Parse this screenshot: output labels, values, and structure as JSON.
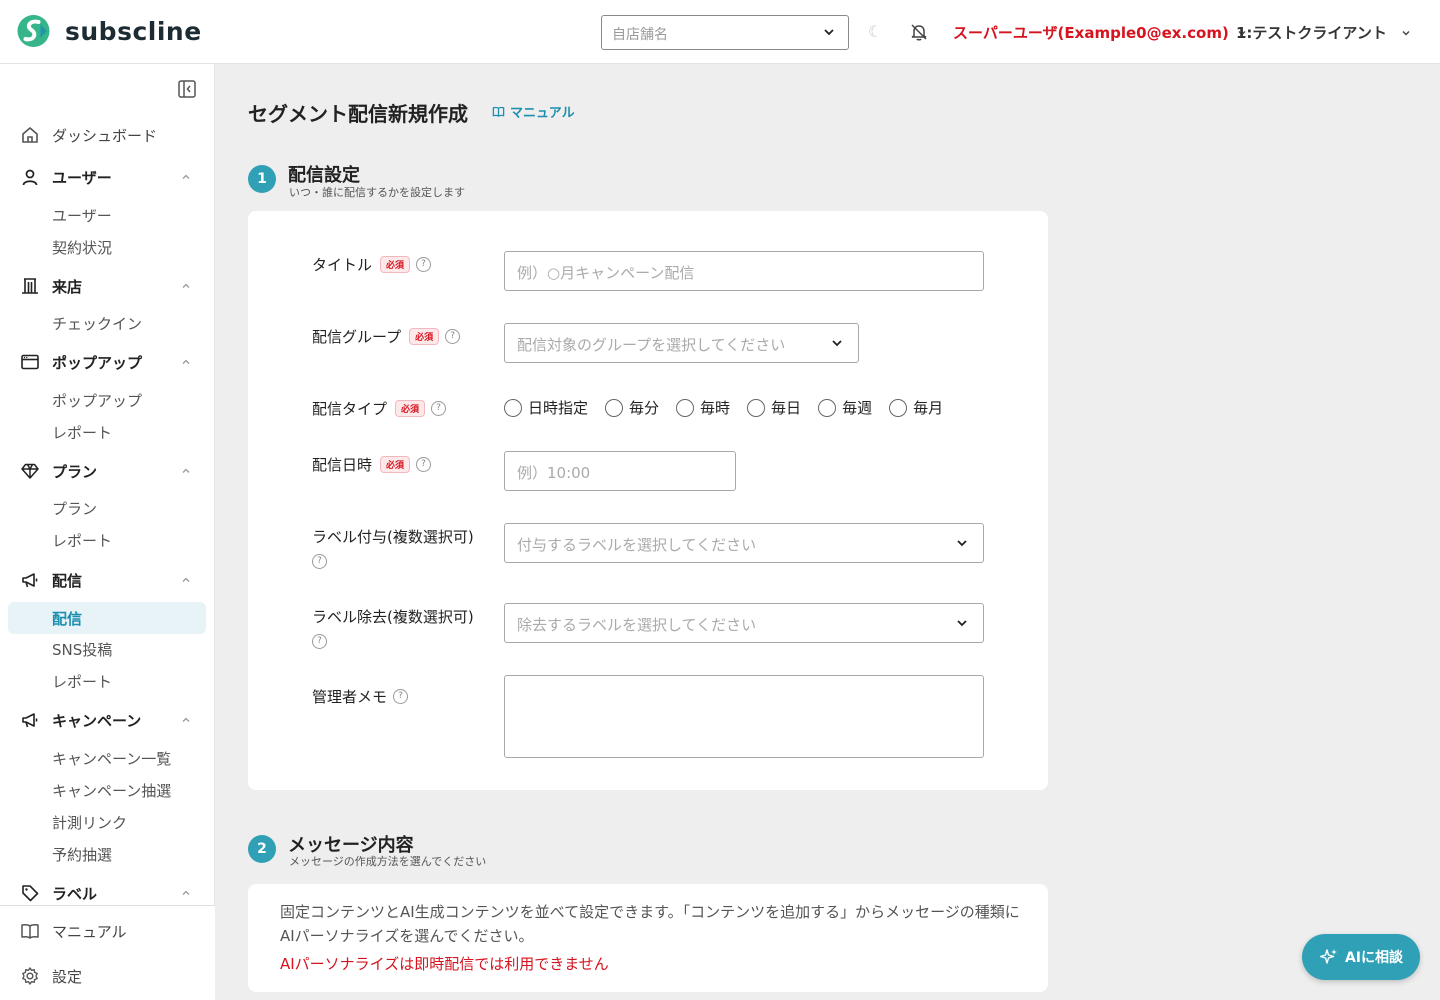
{
  "header": {
    "brand": "subscline",
    "store_placeholder": "自店舗名",
    "theme_glyph": "☾",
    "user_label": "スーパーユーザ(Example0@ex.com)",
    "client_label": "1:テストクライアント"
  },
  "sidebar": {
    "dashboard": "ダッシュボード",
    "groups": {
      "users": {
        "label": "ユーザー",
        "items": [
          "ユーザー",
          "契約状況"
        ]
      },
      "visits": {
        "label": "来店",
        "items": [
          "チェックイン"
        ]
      },
      "popup": {
        "label": "ポップアップ",
        "items": [
          "ポップアップ",
          "レポート"
        ]
      },
      "plan": {
        "label": "プラン",
        "items": [
          "プラン",
          "レポート"
        ]
      },
      "delivery": {
        "label": "配信",
        "items": [
          "配信",
          "SNS投稿",
          "レポート"
        ],
        "active": "配信"
      },
      "campaign": {
        "label": "キャンペーン",
        "items": [
          "キャンペーン一覧",
          "キャンペーン抽選",
          "計測リンク",
          "予約抽選"
        ]
      },
      "label": {
        "label": "ラベル"
      }
    },
    "footer": {
      "manual": "マニュアル",
      "settings": "設定"
    }
  },
  "main": {
    "title": "セグメント配信新規作成",
    "manual_link": "マニュアル",
    "step1": {
      "number": "1",
      "title": "配信設定",
      "subtitle": "いつ・誰に配信するかを設定します"
    },
    "fields": {
      "required_badge": "必須",
      "help_glyph": "?",
      "title": {
        "label": "タイトル",
        "placeholder": "例）○月キャンペーン配信"
      },
      "group": {
        "label": "配信グループ",
        "placeholder": "配信対象のグループを選択してください"
      },
      "type": {
        "label": "配信タイプ",
        "options": [
          "日時指定",
          "毎分",
          "毎時",
          "毎日",
          "毎週",
          "毎月"
        ]
      },
      "datetime": {
        "label": "配信日時",
        "placeholder": "例）10:00"
      },
      "label_add": {
        "label": "ラベル付与(複数選択可)",
        "placeholder": "付与するラベルを選択してください"
      },
      "label_remove": {
        "label": "ラベル除去(複数選択可)",
        "placeholder": "除去するラベルを選択してください"
      },
      "memo": {
        "label": "管理者メモ"
      }
    },
    "step2": {
      "number": "2",
      "title": "メッセージ内容",
      "subtitle": "メッセージの作成方法を選んでください",
      "description": "固定コンテンツとAI生成コンテンツを並べて設定できます。「コンテンツを追加する」からメッセージの種類にAIパーソナライズを選んでください。",
      "warning": "AIパーソナライズは即時配信では利用できません"
    }
  },
  "ai_button": "AIに相談",
  "colors": {
    "accent": "#2fa0b5",
    "brand_red": "#d6131e",
    "link": "#1c8fb0"
  }
}
